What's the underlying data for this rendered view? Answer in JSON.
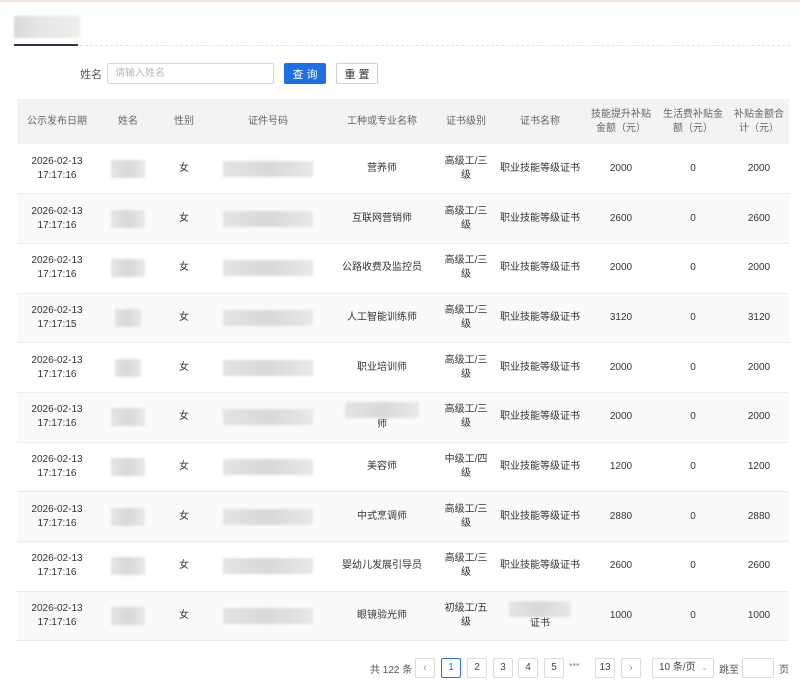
{
  "search": {
    "label": "姓名",
    "placeholder": "请输入姓名",
    "query_label": "查 询",
    "reset_label": "重 置"
  },
  "table": {
    "headers": [
      "公示发布日期",
      "姓名",
      "性别",
      "证件号码",
      "工种或专业名称",
      "证书级别",
      "证书名称",
      "技能提升补贴金额（元）",
      "生活费补贴金额（元）",
      "补贴金额合计（元）"
    ],
    "rows": [
      {
        "date": "2026-02-13",
        "time": "17:17:16",
        "gender": "女",
        "job": "营养师",
        "level": "高级工/三级",
        "cert": "职业技能等级证书",
        "skill": "2000",
        "living": "0",
        "total": "2000"
      },
      {
        "date": "2026-02-13",
        "time": "17:17:16",
        "gender": "女",
        "job": "互联网营销师",
        "level": "高级工/三级",
        "cert": "职业技能等级证书",
        "skill": "2600",
        "living": "0",
        "total": "2600"
      },
      {
        "date": "2026-02-13",
        "time": "17:17:16",
        "gender": "女",
        "job": "公路收费及监控员",
        "level": "高级工/三级",
        "cert": "职业技能等级证书",
        "skill": "2000",
        "living": "0",
        "total": "2000"
      },
      {
        "date": "2026-02-13",
        "time": "17:17:15",
        "gender": "女",
        "job": "人工智能训练师",
        "level": "高级工/三级",
        "cert": "职业技能等级证书",
        "skill": "3120",
        "living": "0",
        "total": "3120"
      },
      {
        "date": "2026-02-13",
        "time": "17:17:16",
        "gender": "女",
        "job": "职业培训师",
        "level": "高级工/三级",
        "cert": "职业技能等级证书",
        "skill": "2000",
        "living": "0",
        "total": "2000"
      },
      {
        "date": "2026-02-13",
        "time": "17:17:16",
        "gender": "女",
        "job": "师",
        "level": "高级工/三级",
        "cert": "职业技能等级证书",
        "skill": "2000",
        "living": "0",
        "total": "2000"
      },
      {
        "date": "2026-02-13",
        "time": "17:17:16",
        "gender": "女",
        "job": "美容师",
        "level": "中级工/四级",
        "cert": "职业技能等级证书",
        "skill": "1200",
        "living": "0",
        "total": "1200"
      },
      {
        "date": "2026-02-13",
        "time": "17:17:16",
        "gender": "女",
        "job": "中式烹调师",
        "level": "高级工/三级",
        "cert": "职业技能等级证书",
        "skill": "2880",
        "living": "0",
        "total": "2880"
      },
      {
        "date": "2026-02-13",
        "time": "17:17:16",
        "gender": "女",
        "job": "婴幼儿发展引导员",
        "level": "高级工/三级",
        "cert": "职业技能等级证书",
        "skill": "2600",
        "living": "0",
        "total": "2600"
      },
      {
        "date": "2026-02-13",
        "time": "17:17:16",
        "gender": "女",
        "job": "眼镜验光师",
        "level": "初级工/五级",
        "cert": "证书",
        "skill": "1000",
        "living": "0",
        "total": "1000"
      }
    ]
  },
  "pagination": {
    "total_text": "共 122 条",
    "pages": [
      "1",
      "2",
      "3",
      "4",
      "5"
    ],
    "ellipsis": "•••",
    "last_page": "13",
    "page_size": "10 条/页",
    "jump_label": "跳至",
    "page_suffix": "页",
    "prev_icon": "chevron-left-icon",
    "next_icon": "chevron-right-icon"
  },
  "colors": {
    "primary": "#1e6fe6",
    "header_bg": "#f2f3f5",
    "tab_underline": "#2d3a4a"
  }
}
